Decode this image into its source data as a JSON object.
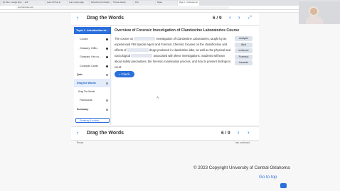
{
  "browser": {
    "tabs": [
      "My Drive - Google Drive",
      "ELP",
      "Learn CS How to",
      "Learn course page",
      "Refreshing Your Reality",
      "Thomas Jacobs",
      "Prim",
      "Pages",
      "Page 1 - Introduction to"
    ],
    "url": "uco.instructure.com"
  },
  "header": {
    "title": "Drag the Words",
    "counter": "6 / 9",
    "prev_icon": "‹",
    "list_icon": "≡",
    "next_icon": "›",
    "expand_icon": "⤢"
  },
  "outline": {
    "section_title": "Topic I - Introduction to...",
    "items": [
      {
        "label": "Course",
        "level": "sub",
        "status": "filled"
      },
      {
        "label": "Glossary: Diffic...",
        "level": "sub",
        "status": "filled"
      },
      {
        "label": "Glossary: Key co...",
        "level": "sub",
        "status": "filled"
      },
      {
        "label": "Concepts Cards",
        "level": "sub",
        "status": "filled"
      },
      {
        "label": "Quiz",
        "level": "top",
        "status": "ring"
      },
      {
        "label": "Drag the Words",
        "level": "top",
        "status": "ring",
        "active": true
      },
      {
        "label": "Drag The Words",
        "level": "child",
        "status": "none"
      },
      {
        "label": "Flashcards",
        "level": "sub",
        "status": "ring"
      },
      {
        "label": "Summary",
        "level": "top",
        "status": "ring"
      }
    ],
    "summary_button": "Summary & submit"
  },
  "content": {
    "title": "Overview of Forensic Investigation of Clandestine Laboratories Course",
    "paragraph": {
      "s1a": "The course on",
      "s1b": "Investigation of Clandestine Laboratories, taught by an experienced FBI Special Agent and Forensic Chemist, focuses on the classification and effects of",
      "s1c": "drugs produced in clandestine labs, as well as the physical and toxicological",
      "s1d": "associated with these investigations. Students will learn about safety precautions, the forensic examination process, and how to present findings in court."
    },
    "words": [
      "analysis",
      "illicit",
      "evidence",
      "Forensic",
      "hazards"
    ],
    "check_label": "Check",
    "check_icon": "●"
  },
  "bottom": {
    "title": "Drag the Words",
    "counter": "6 / 9",
    "prev_icon": "‹",
    "next_icon": "›",
    "up_icon": "↑",
    "footer_left": "Reuse",
    "footer_right": "I am continued"
  },
  "page_footer": {
    "copyright": "© 2023 Copyright University of Central Oklahoma",
    "goto_top": "Go to top"
  }
}
